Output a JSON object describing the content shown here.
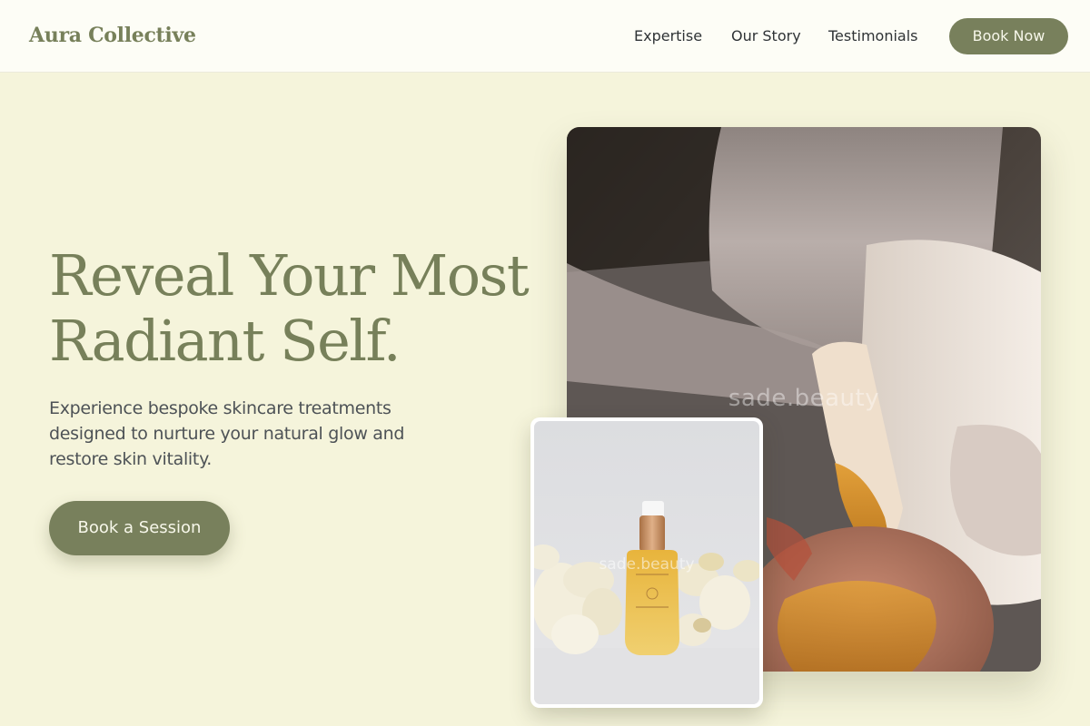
{
  "header": {
    "logo": "Aura Collective",
    "nav": {
      "expertise": "Expertise",
      "story": "Our Story",
      "testimonials": "Testimonials"
    },
    "cta": "Book Now"
  },
  "hero": {
    "title_line1": "Reveal Your Most",
    "title_line2": "Radiant Self.",
    "subtitle": "Experience bespoke skincare treatments designed to nurture your natural glow and restore skin vitality.",
    "cta": "Book a Session"
  },
  "images": {
    "main_watermark": "sade.beauty",
    "product_watermark": "sade.beauty",
    "main_alt": "skincare treatment with honey and bowl",
    "product_alt": "facial oil bottle with flowers"
  },
  "colors": {
    "accent": "#78805c",
    "background": "#f5f4db",
    "header_bg": "#fdfdf6",
    "text_dark": "#2f3336"
  }
}
